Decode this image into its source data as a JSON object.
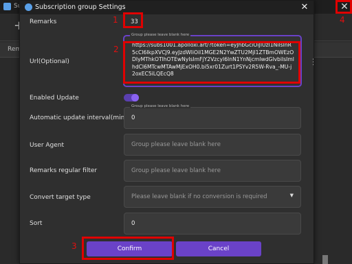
{
  "background": {
    "title": "Sub",
    "column_header": "Rema",
    "close_glyph": "✕",
    "plus_glyph": "+"
  },
  "dialog": {
    "title": "Subscription group Settings",
    "close_glyph": "✕",
    "remarks": {
      "label": "Remarks",
      "value": "33"
    },
    "url": {
      "label": "Url(Optional)",
      "legend": "Group please leave blank here",
      "value": "https://subs1001.apolloxi.art/?token=eyJhbGciOiJIUzI1NiIsInR5cCI6IkpXVCJ9.eyJzdWliOiI1MGE2N2YwZTU2MjI1ZTBmOWEzODIyMThkOTlhOTEwNyIsImFjY2VzcyI6InN1YnNjcmlwdGlvbiIsImlhdCI6MTcwMTAwMjExOH0.bi5xr01Zurt1PSYv2R5W-Rva_-MU-j2oxEC5iLQEcQ8"
    },
    "enabled_update": {
      "label": "Enabled Update",
      "on": true
    },
    "auto_interval": {
      "label": "Automatic update interval(minutes)",
      "legend": "Group please leave blank here",
      "value": "0"
    },
    "user_agent": {
      "label": "User Agent",
      "placeholder": "Group please leave blank here"
    },
    "remarks_filter": {
      "label": "Remarks regular filter",
      "placeholder": "Group please leave blank here"
    },
    "convert_type": {
      "label": "Convert target type",
      "placeholder": "Please leave blank if no conversion is required"
    },
    "sort": {
      "label": "Sort",
      "value": "0"
    },
    "confirm_label": "Confirm",
    "cancel_label": "Cancel",
    "menu_glyph": "⋮",
    "chevron_glyph": "▼"
  },
  "annotations": [
    "1",
    "2",
    "3",
    "4"
  ],
  "colors": {
    "accent": "#6a42c8",
    "annotation": "#e00000"
  }
}
